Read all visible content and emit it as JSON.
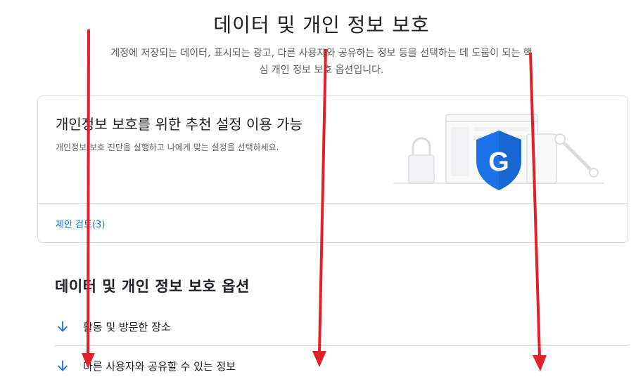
{
  "header": {
    "title": "데이터 및 개인 정보 보호",
    "subtitle": "계정에 저장되는 데이터, 표시되는 광고, 다른 사용자와 공유하는 정보 등을 선택하는 데 도움이 되는 핵심 개인 정보 보호 옵션입니다."
  },
  "recommend_card": {
    "title": "개인정보 보호를 위한 추천 설정 이용 가능",
    "description": "개인정보 보호 진단을 실행하고 나에게 맞는 설정을 선택하세요.",
    "link_label": "제안 검토(3)",
    "shield_letter": "G"
  },
  "options_section": {
    "title": "데이터 및 개인 정보 보호 옵션",
    "items": [
      {
        "label": "활동 및 방문한 장소",
        "icon": "arrow-down-icon"
      },
      {
        "label": "다른 사용자와 공유할 수 있는 정보",
        "icon": "arrow-down-icon"
      }
    ]
  },
  "colors": {
    "accent": "#1a73e8",
    "shield": "#1a73e8",
    "annotation_arrow": "#e3202a"
  }
}
